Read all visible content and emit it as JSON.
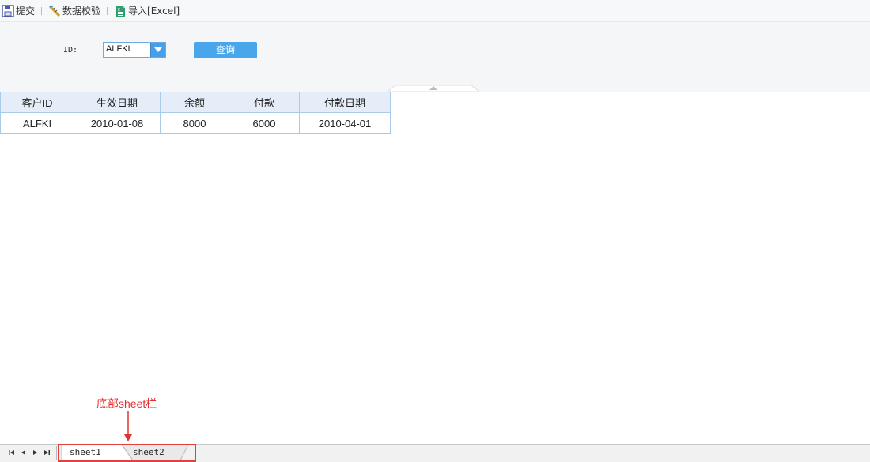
{
  "toolbar": {
    "submit_label": "提交",
    "validate_label": "数据校验",
    "import_label": "导入[Excel]"
  },
  "params": {
    "id_label": "ID:",
    "id_value": "ALFKI",
    "query_label": "查询"
  },
  "table": {
    "headers": [
      "客户ID",
      "生效日期",
      "余额",
      "付款",
      "付款日期"
    ],
    "rows": [
      [
        "ALFKI",
        "2010-01-08",
        "8000",
        "6000",
        "2010-04-01"
      ]
    ]
  },
  "annotation": {
    "text": "底部sheet栏",
    "color": "#e63030"
  },
  "sheets": [
    "sheet1",
    "sheet2"
  ],
  "colors": {
    "accent": "#49a6ea",
    "highlight": "#e04040"
  }
}
